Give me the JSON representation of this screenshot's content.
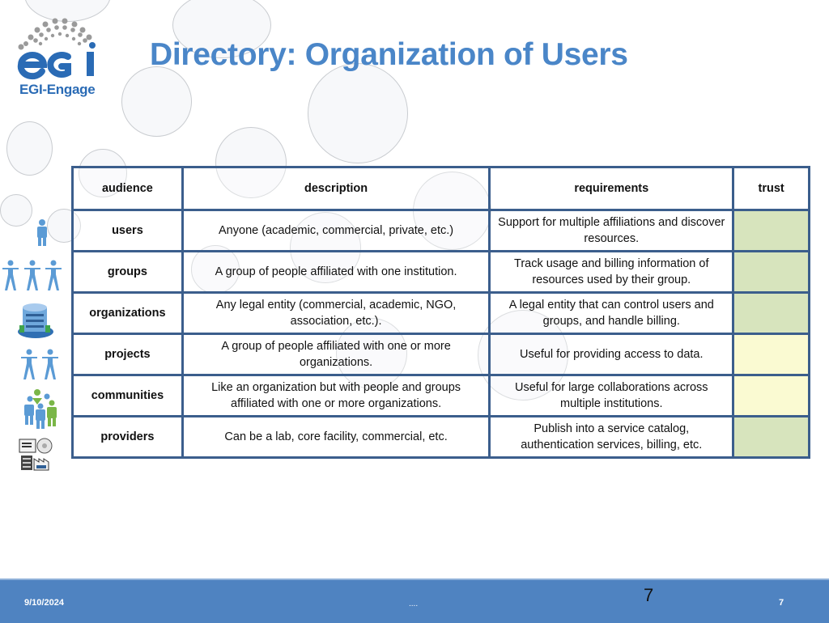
{
  "logo": {
    "text": "EGI-Engage",
    "brand_color": "#2a6bb5",
    "dots_color": "#9a9a9a"
  },
  "title": "Directory: Organization of Users",
  "table": {
    "headers": [
      "audience",
      "description",
      "requirements",
      "trust"
    ],
    "rows": [
      {
        "icon": "single-user-icon",
        "audience": "users",
        "description": "Anyone (academic, commercial, private, etc.)",
        "requirements": "Support for multiple affiliations and discover resources.",
        "trust_color": "#d7e4bd"
      },
      {
        "icon": "group-three-people-icon",
        "audience": "groups",
        "description": "A group of people affiliated with one institution.",
        "requirements": "Track usage and billing information of resources used by their group.",
        "trust_color": "#d7e4bd"
      },
      {
        "icon": "office-building-icon",
        "audience": "organizations",
        "description": "Any legal entity (commercial, academic, NGO, association, etc.).",
        "requirements": "A legal entity that can control users and groups, and handle billing.",
        "trust_color": "#d7e4bd"
      },
      {
        "icon": "two-people-icon",
        "audience": "projects",
        "description": "A group of people affiliated with one or more organizations.",
        "requirements": "Useful for providing access to data.",
        "trust_color": "#fafad2"
      },
      {
        "icon": "community-people-icon",
        "audience": "communities",
        "description": "Like an organization but with people and groups affiliated with one or more organizations.",
        "requirements": "Useful for large collaborations across multiple institutions.",
        "trust_color": "#fafad2"
      },
      {
        "icon": "provider-facility-icon",
        "audience": "providers",
        "description": "Can be a lab, core facility, commercial, etc.",
        "requirements": "Publish into a service catalog, authentication services, billing, etc.",
        "trust_color": "#d7e4bd"
      }
    ]
  },
  "footer": {
    "date": "9/10/2024",
    "center": "....",
    "slide_number_large": "7",
    "slide_number": "7",
    "bar_color": "#4f83c1"
  }
}
